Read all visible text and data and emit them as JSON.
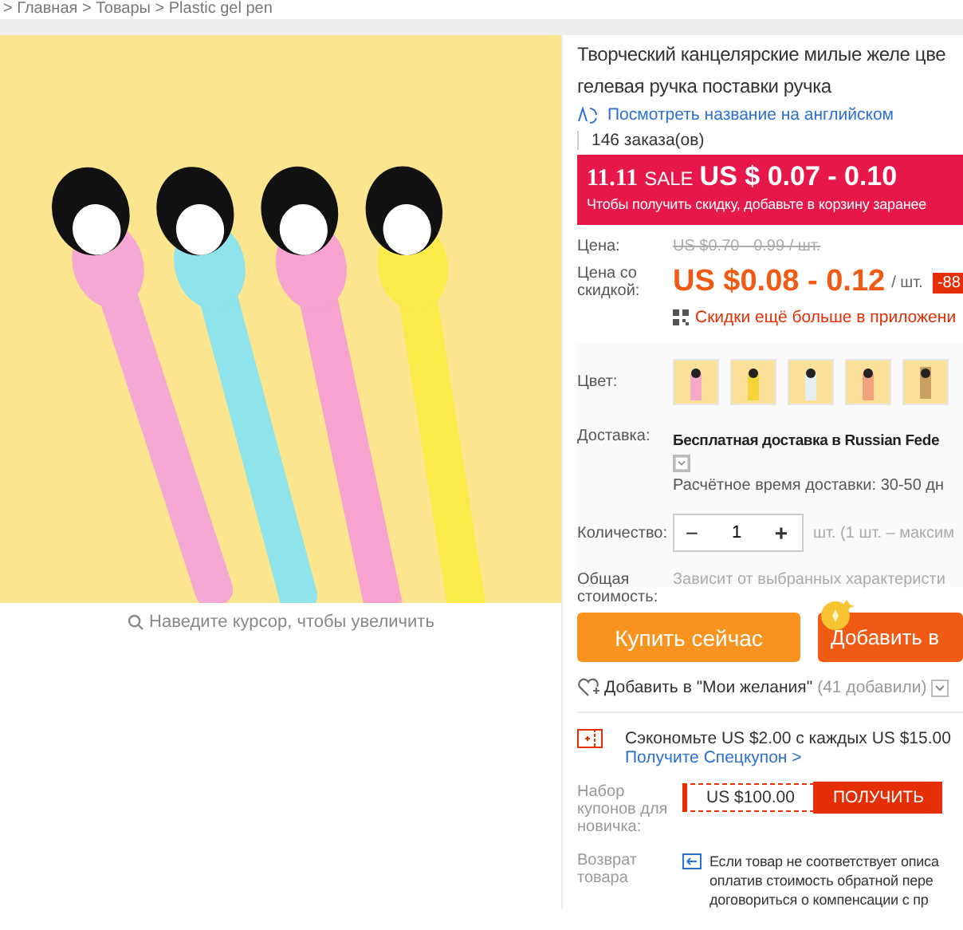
{
  "breadcrumb": "> Главная > Товары > Plastic gel pen",
  "gallery": {
    "zoom_hint": "Наведите курсор, чтобы увеличить"
  },
  "product": {
    "title_lines": [
      "Творческий канцелярские милые желе цве",
      "гелевая ручка поставки ручка"
    ],
    "translate_link": "Посмотреть название на английском",
    "orders": "146 заказа(ов)"
  },
  "sale_banner": {
    "event": "11.11",
    "sale": "SALE",
    "price": "US $ 0.07 - 0.10",
    "note": "Чтобы получить скидку, добавьте в корзину заранее"
  },
  "price": {
    "label": "Цена:",
    "original": "US $0.70 - 0.99 / шт."
  },
  "discount": {
    "label": "Цена со скидкой:",
    "value": "US $0.08 - 0.12",
    "unit": "/ шт.",
    "badge": "-88",
    "app_promo": "Скидки ещё больше в приложени"
  },
  "color": {
    "label": "Цвет:",
    "swatches": [
      {
        "color": "#f4a9c8"
      },
      {
        "color": "#f5d43a"
      },
      {
        "color": "#e4eef0"
      },
      {
        "color": "#f3a27e"
      },
      {
        "color": "#c9a060"
      }
    ]
  },
  "shipping": {
    "label": "Доставка:",
    "text": "Бесплатная доставка в Russian Fede",
    "estimate_label": "Расчётное время доставки:",
    "estimate_value": "30-50 дн"
  },
  "quantity": {
    "label": "Количество:",
    "minus": "−",
    "value": "1",
    "plus": "+",
    "note": "шт. (1 шт. – максим"
  },
  "total": {
    "label": "Общая стоимость:",
    "value": "Зависит от выбранных характеристи"
  },
  "buttons": {
    "buy": "Купить сейчас",
    "cart": "Добавить в"
  },
  "wishlist": {
    "text": "Добавить в \"Мои желания\"",
    "count": "(41 добавили)"
  },
  "coupon": {
    "text": "Сэкономьте US $2.00 с каждых US $15.00",
    "link": "Получите Спецкупон >"
  },
  "newbie": {
    "label": "Набор купонов для новичка:",
    "amount": "US $100.00",
    "button": "ПОЛУЧИТЬ"
  },
  "returns": {
    "label": "Возврат товара",
    "lines": [
      "Если товар не соответствует описа",
      "оплатив стоимость обратной пере",
      "договориться о компенсации с пр"
    ]
  }
}
